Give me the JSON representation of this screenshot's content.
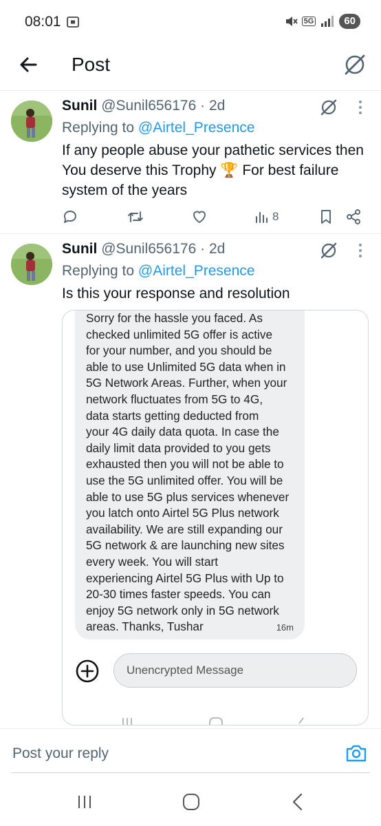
{
  "status_bar": {
    "time": "08:01",
    "network": "5G",
    "battery": "60"
  },
  "header": {
    "title": "Post"
  },
  "tweets": [
    {
      "name": "Sunil",
      "handle": "@Sunil656176",
      "age": "· 2d",
      "replying_prefix": "Replying to",
      "replying_to": "@Airtel_Presence",
      "text": "If any people abuse your pathetic services then You deserve this Trophy 🏆  For best failure system of the years",
      "views": "8"
    },
    {
      "name": "Sunil",
      "handle": "@Sunil656176",
      "age": "· 2d",
      "replying_prefix": "Replying to",
      "replying_to": "@Airtel_Presence",
      "text": "Is this your response and resolution",
      "embed": {
        "message_lines": [
          "Sorry for the hassle you faced. As",
          "checked unlimited 5G offer is active",
          "for your number, and you should be",
          "able to use Unlimited 5G data when in",
          "5G Network Areas. Further, when your",
          "network fluctuates from 5G to 4G,",
          "data starts getting deducted from",
          "your 4G daily data quota. In case the",
          "daily limit data provided to you gets",
          "exhausted then you will not be able to",
          "use the 5G unlimited offer. You will be",
          "able to use 5G plus services whenever",
          "you latch onto Airtel 5G Plus network",
          "availability. We are still expanding our",
          "5G network & are launching new sites",
          "every week. You will start",
          "experiencing Airtel 5G Plus with Up to",
          "20-30 times faster speeds. You can",
          "enjoy 5G network only in 5G network",
          "areas. Thanks, Tushar"
        ],
        "message_time": "16m",
        "input_placeholder": "Unencrypted Message"
      }
    }
  ],
  "reply_bar": {
    "placeholder": "Post your reply"
  },
  "colors": {
    "accent": "#1d9bf0",
    "secondary_text": "#536471",
    "divider": "#eff3f4"
  },
  "icons": [
    "back-arrow-icon",
    "grok-icon",
    "more-vertical-icon",
    "reply-icon",
    "retweet-icon",
    "like-icon",
    "views-icon",
    "bookmark-icon",
    "share-icon",
    "plus-circle-icon",
    "camera-icon",
    "recents-icon",
    "home-icon",
    "back-icon"
  ]
}
